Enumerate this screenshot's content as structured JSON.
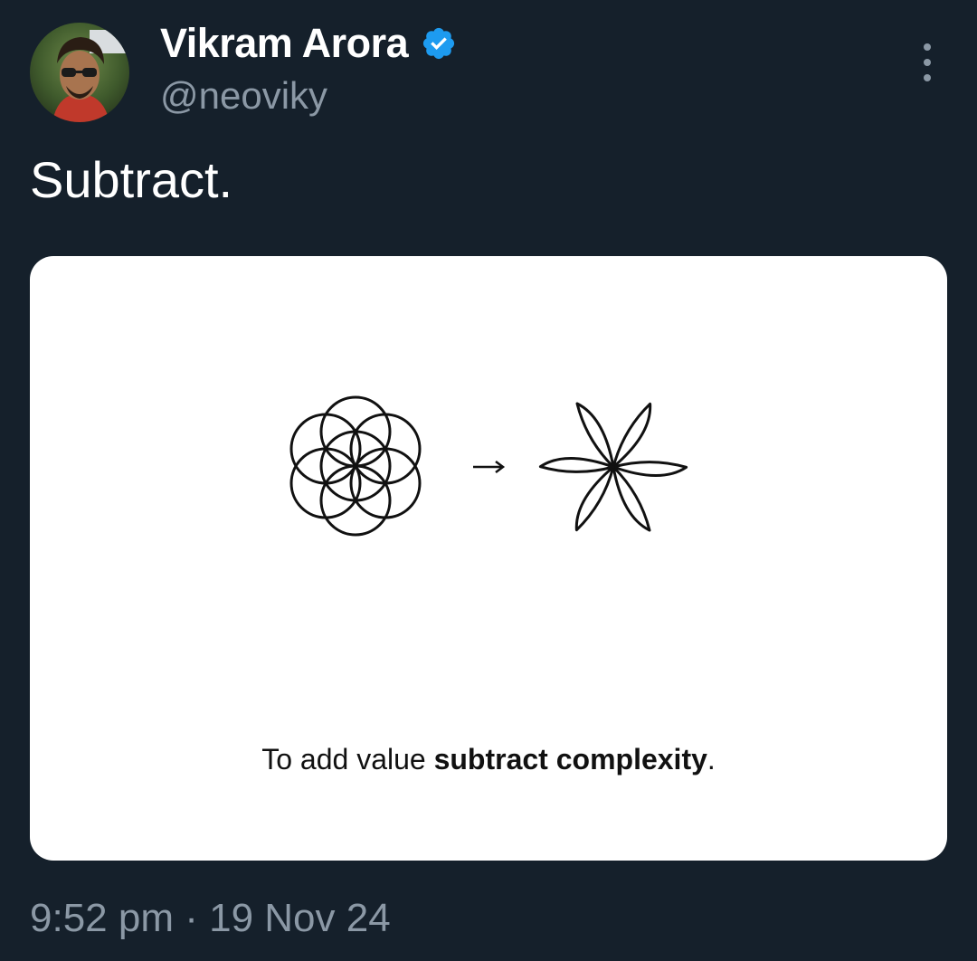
{
  "author": {
    "display_name": "Vikram Arora",
    "handle": "@neoviky",
    "verified": true,
    "verified_color": "#1d9bf0"
  },
  "tweet": {
    "text": "Subtract."
  },
  "media": {
    "caption_regular": "To add value ",
    "caption_bold": "subtract complexity",
    "caption_end": ".",
    "arrow": "→",
    "left_figure": "seed-of-life-circles",
    "right_figure": "six-petal-flower"
  },
  "meta": {
    "time": "9:52 pm",
    "separator": "·",
    "date": "19 Nov 24"
  },
  "icons": {
    "more": "more-vertical-icon",
    "verified": "verified-badge-icon"
  },
  "colors": {
    "background": "#15202b",
    "text_primary": "#ffffff",
    "text_secondary": "#8b98a5",
    "card": "#ffffff"
  }
}
